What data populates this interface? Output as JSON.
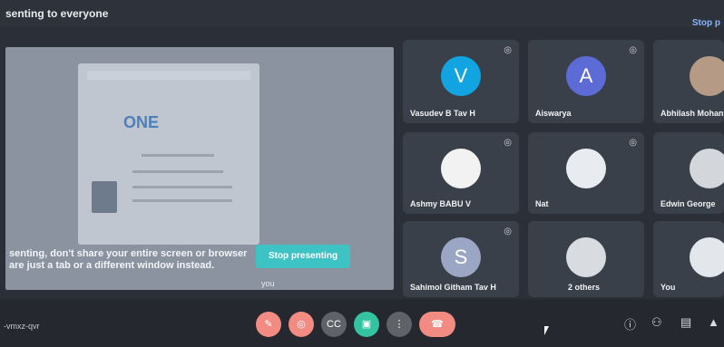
{
  "header": {
    "title": "senting to everyone",
    "right_link": "Stop p"
  },
  "presentation": {
    "doc_logo": "ONE",
    "warning_line1": "senting, don't share your entire screen or browser",
    "warning_line2": "are just a tab or a different window instead.",
    "stop_button": "Stop presenting",
    "presenter_tag": "you"
  },
  "participants": [
    {
      "name": "Vasudev B Tav H",
      "initial": "V",
      "color": "#12a4e0"
    },
    {
      "name": "Aiswarya",
      "initial": "A",
      "color": "#5d6bd6"
    },
    {
      "name": "Abhilash Mohan",
      "initial": "",
      "color": "#b59a86"
    },
    {
      "name": "Ashmy BABU V",
      "initial": "",
      "color": "#f2f2f2"
    },
    {
      "name": "Nat",
      "initial": "",
      "color": "#e8ecf1"
    },
    {
      "name": "Edwin George",
      "initial": "",
      "color": "#d3d7dc"
    },
    {
      "name": "Sahimol Githam Tav H",
      "initial": "S",
      "color": "#9aa6c4"
    },
    {
      "name": "2 others",
      "initial": "",
      "color": "#d8dbe0"
    },
    {
      "name": "You",
      "initial": "",
      "color": "#e3e7ec"
    }
  ],
  "footer": {
    "meeting_code": "-vmxz-qvr"
  },
  "controls": {
    "mic": "✎",
    "cam": "◎",
    "cc": "CC",
    "present": "▣",
    "more": "⋮",
    "end": "☎",
    "info": "ⓘ",
    "people": "⚇",
    "chat": "▤",
    "activities": "▲"
  },
  "colors": {
    "end_call": "#f28b82",
    "present_active": "#34c3a0",
    "stop_presenting": "#3ec3c5",
    "accent_link": "#8ab4f8"
  }
}
